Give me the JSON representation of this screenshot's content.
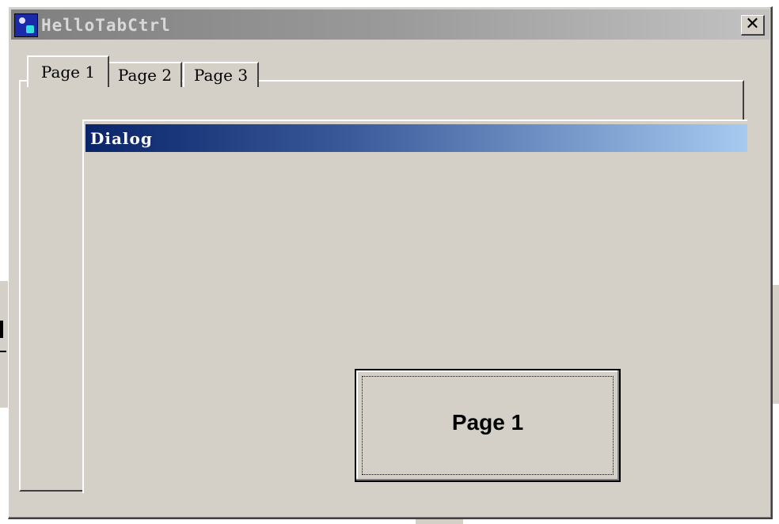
{
  "window": {
    "title": "HelloTabCtrl",
    "close_glyph": "✕"
  },
  "tabs": [
    {
      "label": "Page 1",
      "active": true
    },
    {
      "label": "Page 2",
      "active": false
    },
    {
      "label": "Page 3",
      "active": false
    }
  ],
  "dialog": {
    "title": "Dialog",
    "button_label": "Page 1"
  },
  "colors": {
    "face": "#d4d0c8",
    "active_title_start": "#0a246a",
    "active_title_end": "#a6caf0",
    "inactive_title_start": "#7f7f7f",
    "inactive_title_end": "#c2c2c2"
  },
  "icons": [
    "app-icon",
    "close-icon"
  ]
}
